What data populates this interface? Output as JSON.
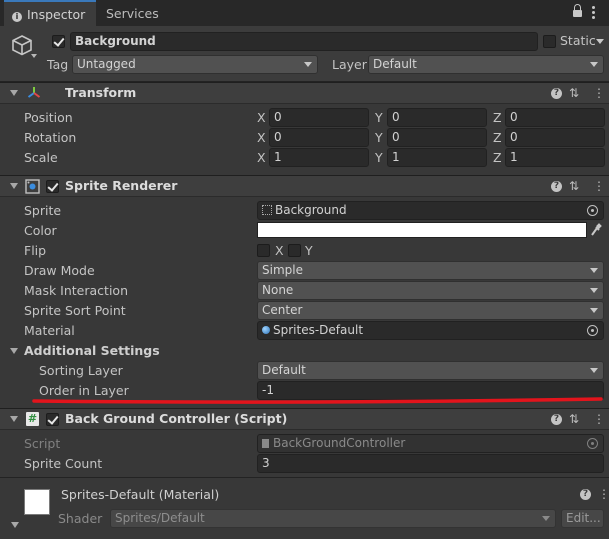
{
  "tabs": {
    "inspector": "Inspector",
    "services": "Services"
  },
  "header": {
    "name": "Background",
    "static_label": "Static",
    "tag_label": "Tag",
    "tag_value": "Untagged",
    "layer_label": "Layer",
    "layer_value": "Default"
  },
  "transform": {
    "title": "Transform",
    "rows": [
      {
        "label": "Position",
        "x": "0",
        "y": "0",
        "z": "0"
      },
      {
        "label": "Rotation",
        "x": "0",
        "y": "0",
        "z": "0"
      },
      {
        "label": "Scale",
        "x": "1",
        "y": "1",
        "z": "1"
      }
    ],
    "axis_x": "X",
    "axis_y": "Y",
    "axis_z": "Z"
  },
  "sprite_renderer": {
    "title": "Sprite Renderer",
    "sprite_label": "Sprite",
    "sprite_value": "Background",
    "color_label": "Color",
    "color_value": "#ffffff",
    "flip_label": "Flip",
    "flip_x": "X",
    "flip_y": "Y",
    "draw_mode_label": "Draw Mode",
    "draw_mode_value": "Simple",
    "mask_label": "Mask Interaction",
    "mask_value": "None",
    "sort_point_label": "Sprite Sort Point",
    "sort_point_value": "Center",
    "material_label": "Material",
    "material_value": "Sprites-Default",
    "additional_label": "Additional Settings",
    "sorting_layer_label": "Sorting Layer",
    "sorting_layer_value": "Default",
    "order_label": "Order in Layer",
    "order_value": "-1"
  },
  "controller": {
    "title": "Back Ground Controller (Script)",
    "script_label": "Script",
    "script_value": "BackGroundController",
    "count_label": "Sprite Count",
    "count_value": "3"
  },
  "material": {
    "title": "Sprites-Default (Material)",
    "shader_label": "Shader",
    "shader_value": "Sprites/Default",
    "edit_label": "Edit..."
  },
  "colors": {
    "annotation": "#e3141c",
    "accent": "#3a79bb"
  }
}
